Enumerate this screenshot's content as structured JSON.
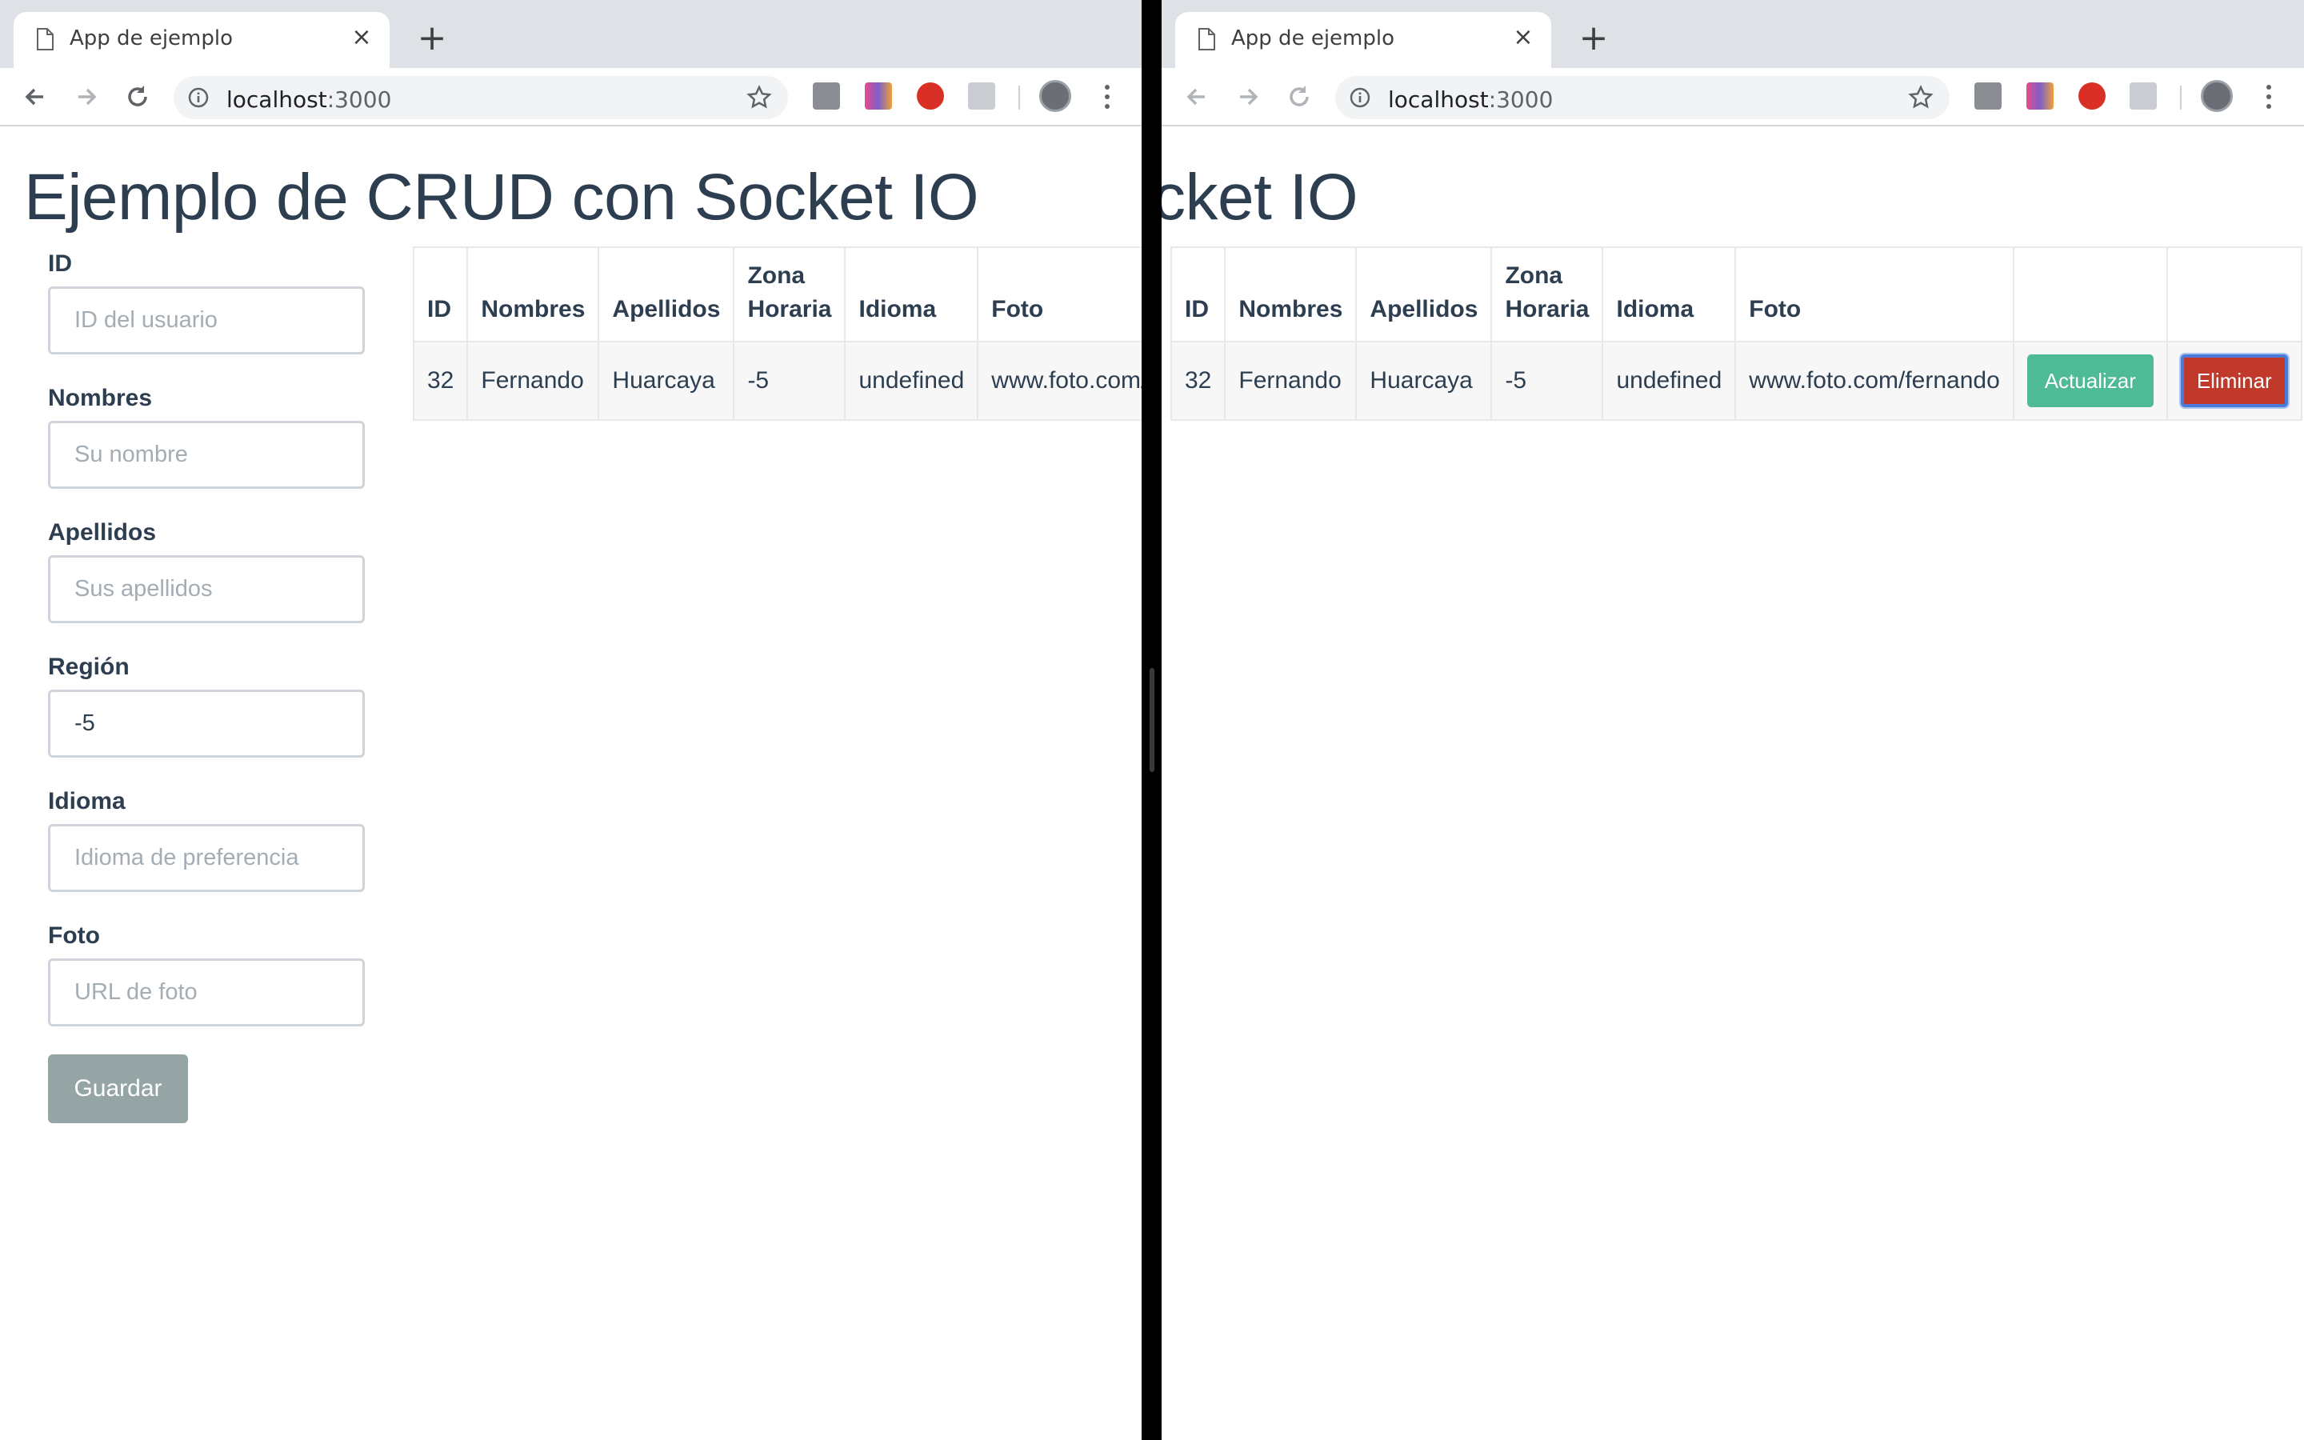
{
  "browser": {
    "tab_title": "App de ejemplo",
    "tab_close": "×",
    "new_tab": "+",
    "url_host": "localhost",
    "url_port": ":3000"
  },
  "page": {
    "heading": "Ejemplo de CRUD con Socket IO"
  },
  "form": {
    "id_label": "ID",
    "id_placeholder": "ID del usuario",
    "id_value": "",
    "nombres_label": "Nombres",
    "nombres_placeholder": "Su nombre",
    "nombres_value": "",
    "apellidos_label": "Apellidos",
    "apellidos_placeholder": "Sus apellidos",
    "apellidos_value": "",
    "region_label": "Región",
    "region_placeholder": "",
    "region_value": "-5",
    "idioma_label": "Idioma",
    "idioma_placeholder": "Idioma de preferencia",
    "idioma_value": "",
    "foto_label": "Foto",
    "foto_placeholder": "URL de foto",
    "foto_value": "",
    "save_label": "Guardar"
  },
  "table": {
    "headers": {
      "id": "ID",
      "nombres": "Nombres",
      "apellidos": "Apellidos",
      "zona_1": "Zona",
      "zona_2": "Horaria",
      "idioma": "Idioma",
      "foto": "Foto"
    },
    "rows": [
      {
        "id": "32",
        "nombres": "Fernando",
        "apellidos": "Huarcaya",
        "zona": "-5",
        "idioma": "undefined",
        "foto": "www.foto.com/fernando",
        "update_label": "Actualizar",
        "delete_label": "Eliminar"
      }
    ]
  },
  "colors": {
    "heading": "#2c3e50",
    "update_button": "#4fba96",
    "delete_button": "#c0392b",
    "save_button": "#95a5a6"
  }
}
